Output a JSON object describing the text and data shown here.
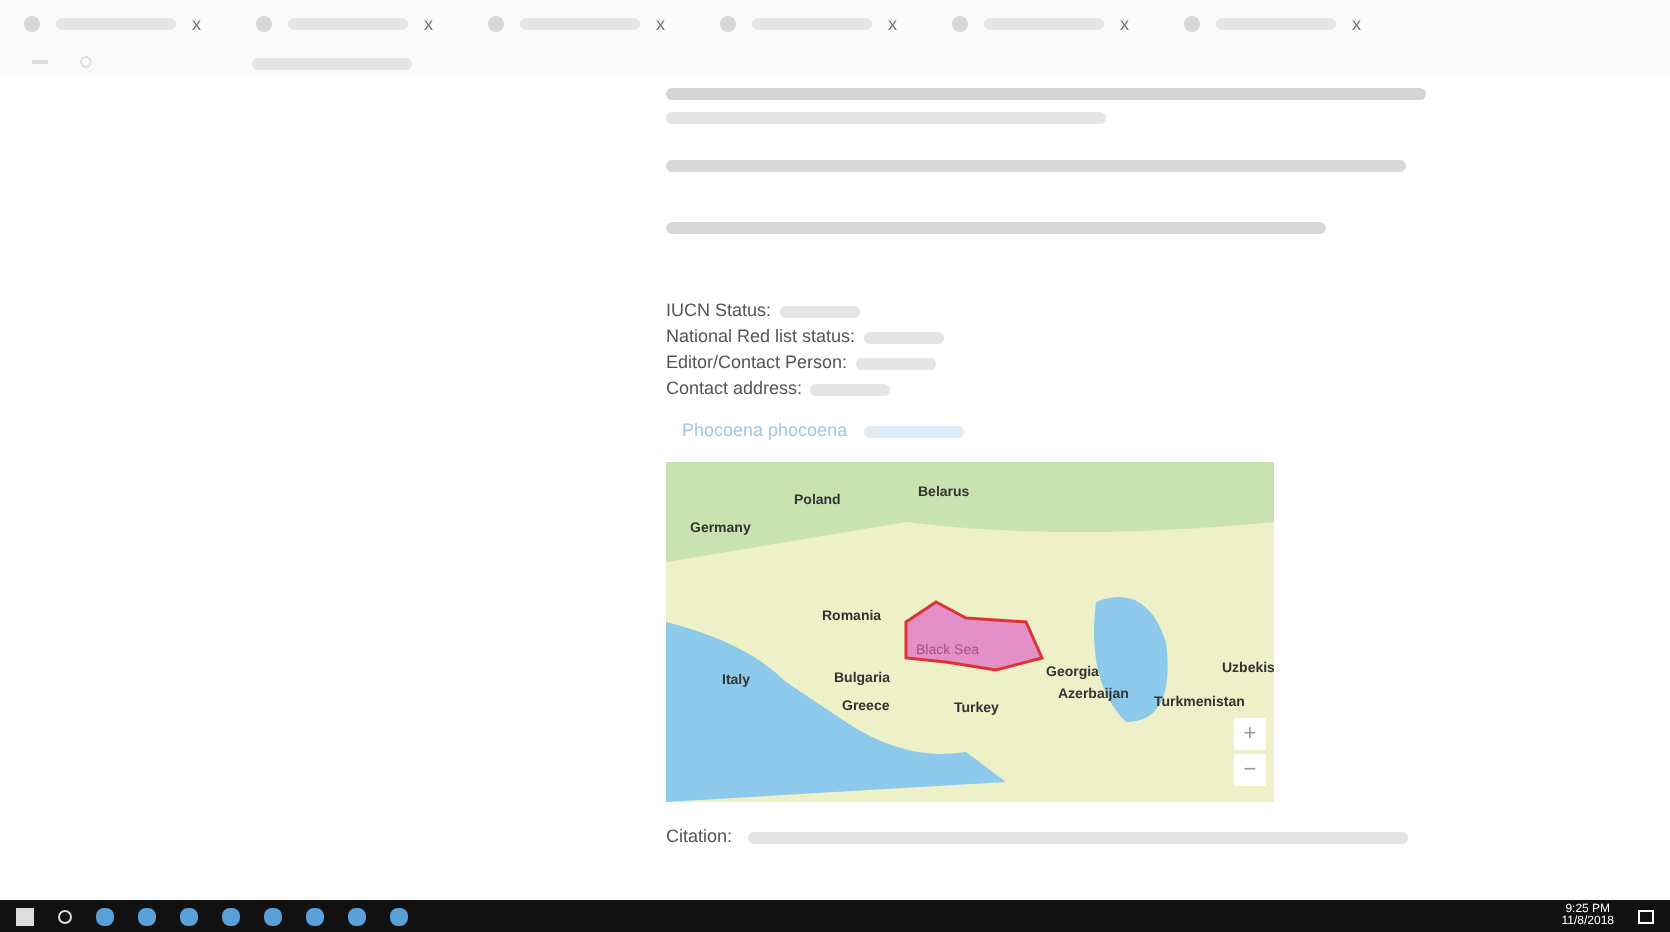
{
  "browser": {
    "tab_count_icons": [
      "x",
      "x",
      "x",
      "x",
      "x",
      "x"
    ]
  },
  "record": {
    "fields": [
      {
        "label": "IUCN Status:"
      },
      {
        "label": "National Red list status:"
      },
      {
        "label": "Editor/Contact Person:"
      },
      {
        "label": "Contact address:"
      }
    ],
    "species_link": "Phocoena phocoena"
  },
  "map": {
    "labels": [
      {
        "text": "Poland",
        "kind": "country"
      },
      {
        "text": "Belarus",
        "kind": "country"
      },
      {
        "text": "Germany",
        "kind": "country"
      },
      {
        "text": "Romania",
        "kind": "country"
      },
      {
        "text": "Bulgaria",
        "kind": "country"
      },
      {
        "text": "Greece",
        "kind": "country"
      },
      {
        "text": "Turkey",
        "kind": "country"
      },
      {
        "text": "Georgia",
        "kind": "country"
      },
      {
        "text": "Azerbaijan",
        "kind": "country"
      },
      {
        "text": "Turkmenistan",
        "kind": "country"
      },
      {
        "text": "Italy",
        "kind": "country"
      },
      {
        "text": "Uzbekis",
        "kind": "country"
      },
      {
        "text": "Black Sea",
        "kind": "sea"
      }
    ],
    "zoom_in": "+",
    "zoom_out": "−"
  },
  "citation": {
    "label": "Citation:"
  },
  "taskbar": {
    "time": "9:25 PM",
    "date": "11/8/2018"
  }
}
